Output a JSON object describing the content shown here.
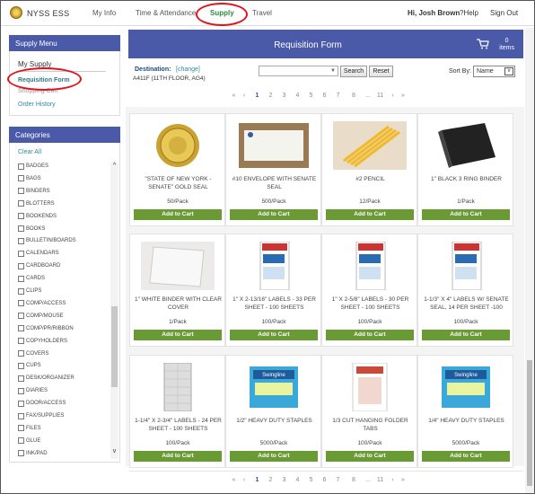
{
  "header": {
    "brand": "NYSS ESS",
    "nav": [
      "My Info",
      "Time & Attendance",
      "Supply",
      "Travel"
    ],
    "greeting": "Hi, Josh Brown",
    "help": "Help",
    "help_icon": "?",
    "signout": "Sign Out"
  },
  "supply_menu": {
    "header": "Supply Menu",
    "title": "My Supply",
    "links": [
      "Requisition Form",
      "Shopping Cart",
      "Order History"
    ]
  },
  "categories": {
    "header": "Categories",
    "clear_all": "Clear All",
    "items": [
      "BADGES",
      "BAGS",
      "BINDERS",
      "BLOTTERS",
      "BOOKENDS",
      "BOOKS",
      "BULLETIN/BOARDS",
      "CALENDARS",
      "CARDBOARD",
      "CARDS",
      "CLIPS",
      "COMP/ACCESS",
      "COMP/MOUSE",
      "COMP/PR/RIBBON",
      "COPYHOLDERS",
      "COVERS",
      "CUPS",
      "DESK/ORGANIZER",
      "DIARIES",
      "DOOR/ACCESS",
      "FAX/SUPPLIES",
      "FILES",
      "GLUE",
      "INK/PAD"
    ]
  },
  "requisition": {
    "title": "Requisition Form",
    "cart_count": "0",
    "cart_unit": "items",
    "destination_label": "Destination:",
    "destination_change": "[change]",
    "destination_value": "A411F (11TH FLOOR, AG4)",
    "search_button": "Search",
    "reset_button": "Reset",
    "sort_label": "Sort By:",
    "sort_value": "Name"
  },
  "pagination": [
    "«",
    "‹",
    "1",
    "2",
    "3",
    "4",
    "5",
    "6",
    "7",
    "8",
    "...",
    "11",
    "›",
    "»"
  ],
  "add_label": "Add to Cart",
  "products": [
    {
      "name": "\"STATE OF NEW YORK - SENATE\" GOLD SEAL",
      "unit": "50/Pack",
      "img": "seal"
    },
    {
      "name": "#10 ENVELOPE WITH SENATE SEAL",
      "unit": "500/Pack",
      "img": "envelope"
    },
    {
      "name": "#2 PENCIL",
      "unit": "12/Pack",
      "img": "pencil"
    },
    {
      "name": "1\" BLACK 3 RING BINDER",
      "unit": "1/Pack",
      "img": "black-binder"
    },
    {
      "name": "1\" WHITE BINDER WITH CLEAR COVER",
      "unit": "1/Pack",
      "img": "white-binder"
    },
    {
      "name": "1\" X 2-13/16\" LABELS - 33 PER SHEET - 100 SHEETS",
      "unit": "100/Pack",
      "img": "labels"
    },
    {
      "name": "1\" X 2-5/8\" LABELS - 30 PER SHEET - 100 SHEETS",
      "unit": "100/Pack",
      "img": "labels"
    },
    {
      "name": "1-1/3\" X 4\" LABELS W/ SENATE SEAL, 14 PER SHEET -100",
      "unit": "100/Pack",
      "img": "labels"
    },
    {
      "name": "1-1/4\" X 2-3/4\" LABELS - 24 PER SHEET - 100 SHEETS",
      "unit": "100/Pack",
      "img": "label-sheet"
    },
    {
      "name": "1/2\" HEAVY DUTY STAPLES",
      "unit": "5000/Pack",
      "img": "staples"
    },
    {
      "name": "1/3 CUT HANGING FOLDER TABS",
      "unit": "100/Pack",
      "img": "tabs"
    },
    {
      "name": "1/4\" HEAVY DUTY STAPLES",
      "unit": "5000/Pack",
      "img": "staples"
    }
  ]
}
